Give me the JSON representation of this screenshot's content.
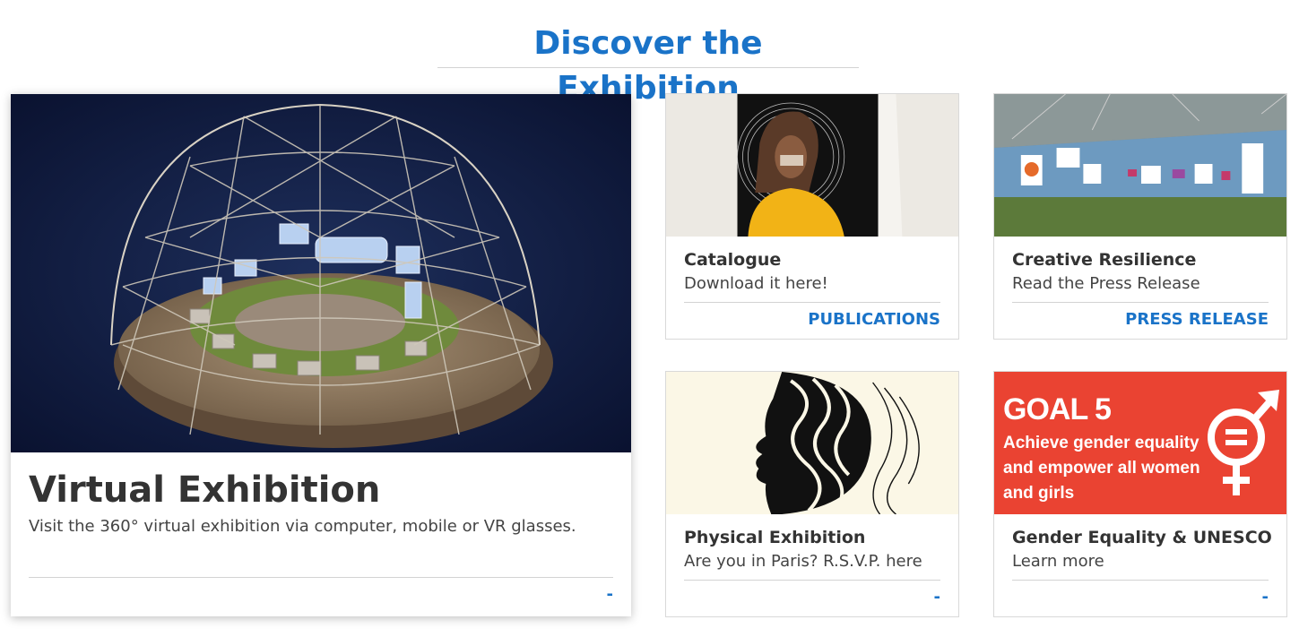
{
  "page": {
    "title": "Discover the Exhibition"
  },
  "cards": {
    "virtual": {
      "title": "Virtual Exhibition",
      "description": "Visit the 360° virtual exhibition via computer, mobile or VR glasses.",
      "link": "-"
    },
    "catalogue": {
      "title": "Catalogue",
      "description": "Download it here!",
      "link": "PUBLICATIONS"
    },
    "resilience": {
      "title": "Creative Resilience",
      "description": "Read the Press Release",
      "link": "PRESS RELEASE"
    },
    "physical": {
      "title": "Physical Exhibition",
      "description": "Are you in Paris? R.S.V.P. here",
      "link": "-"
    },
    "gender": {
      "title": "Gender Equality & UNESCO",
      "description": "Learn more",
      "link": "-",
      "image_text": {
        "goal": "GOAL 5",
        "line1": "Achieve gender equality",
        "line2": "and empower all women",
        "line3": "and girls"
      }
    }
  },
  "colors": {
    "accent": "#1a73c8",
    "goal_red": "#e5243b"
  }
}
